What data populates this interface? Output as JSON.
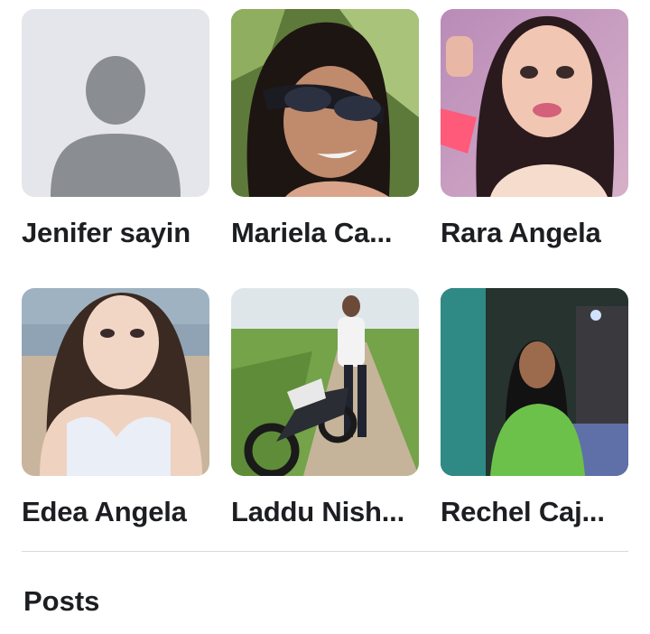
{
  "friends": [
    {
      "name": "Jenifer sayin",
      "photo": "default-avatar-icon"
    },
    {
      "name": "Mariela Ca...",
      "photo": "profile-photo"
    },
    {
      "name": "Rara Angela",
      "photo": "profile-photo"
    },
    {
      "name": "Edea Angela",
      "photo": "profile-photo"
    },
    {
      "name": "Laddu Nish...",
      "photo": "profile-photo"
    },
    {
      "name": "Rechel Caj...",
      "photo": "profile-photo"
    }
  ],
  "section_title": "Posts",
  "colors": {
    "placeholder_bg": "#e4e6eb",
    "placeholder_icon": "#8a8d91",
    "divider": "#d9dadc",
    "text": "#1c1e21"
  }
}
